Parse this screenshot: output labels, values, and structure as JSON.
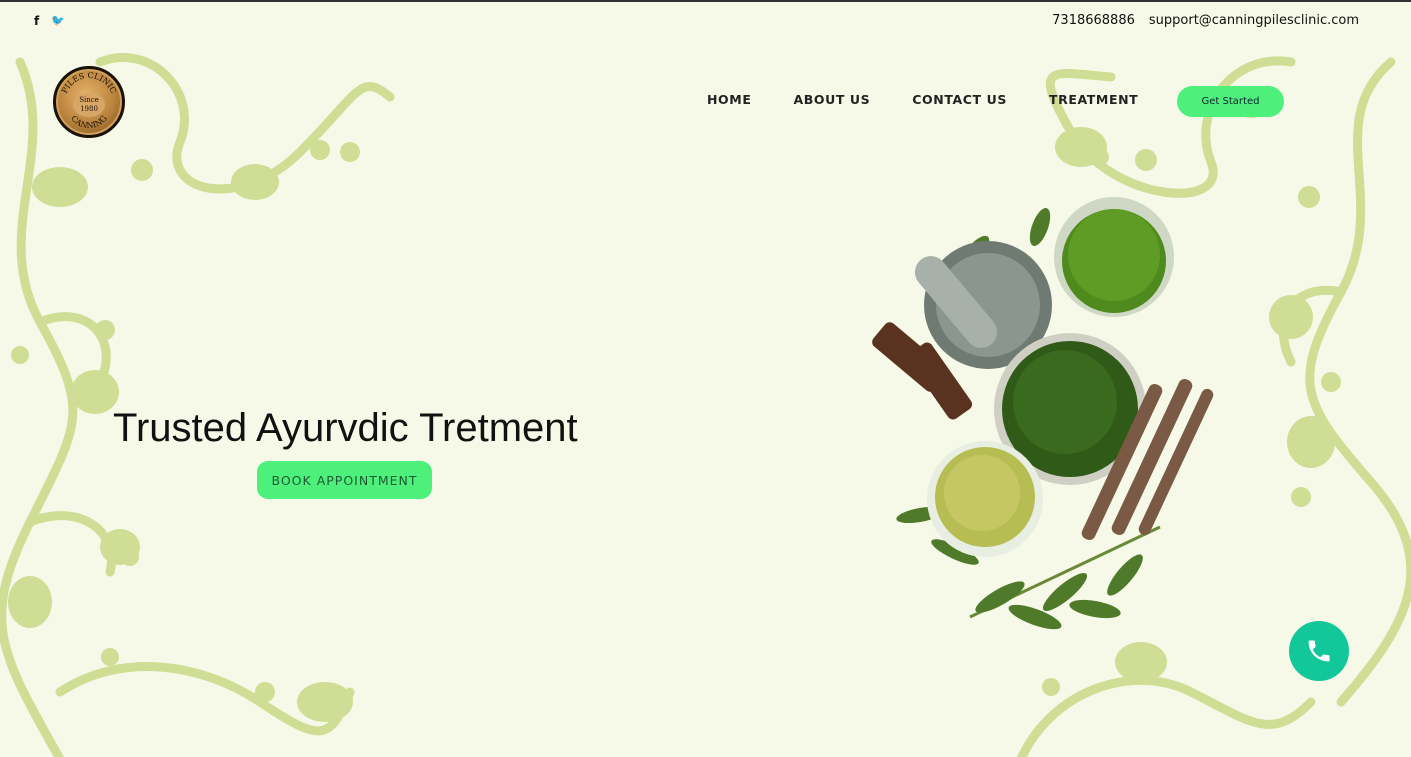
{
  "topbar": {
    "social": [
      {
        "icon": "facebook-icon",
        "glyph": "f"
      },
      {
        "icon": "twitter-icon",
        "glyph": "🐦"
      }
    ],
    "phone": "7318668886",
    "email": "support@canningpilesclinic.com"
  },
  "logo": {
    "ring_top": "PILES CLINIC",
    "ring_bottom": "CANNING",
    "since": "Since",
    "year": "1980"
  },
  "nav": {
    "items": [
      "HOME",
      "ABOUT US",
      "CONTACT US",
      "TREATMENT"
    ],
    "cta": "Get Started"
  },
  "hero": {
    "title": "Trusted Ayurvdic Tretment",
    "button": "BOOK APPOINTMENT"
  },
  "fab": {
    "icon": "phone-icon"
  },
  "colors": {
    "background": "#f6f9e7",
    "accent": "#4cf07a",
    "floral": "#cfdd95",
    "fab": "#12c79a"
  }
}
